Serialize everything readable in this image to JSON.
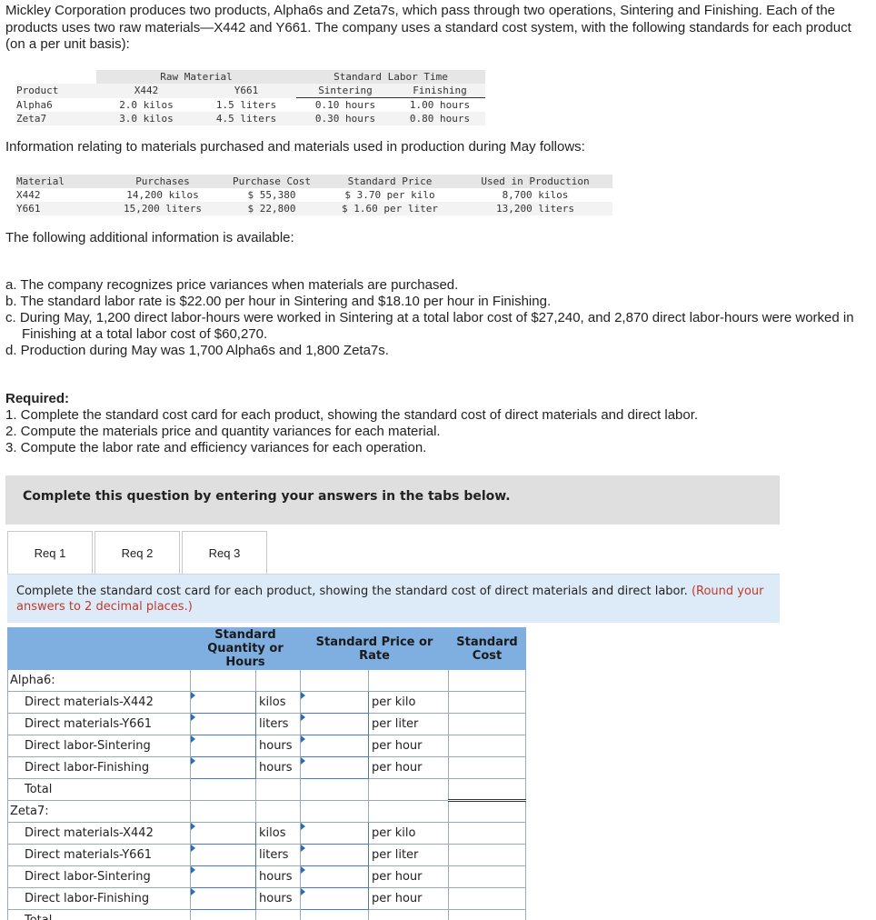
{
  "intro": "Mickley Corporation produces two products, Alpha6s and Zeta7s, which pass through two operations, Sintering and Finishing. Each of the products uses two raw materials—X442 and Y661. The company uses a standard cost system, with the following standards for each product (on a per unit basis):",
  "std_table": {
    "group_raw": "Raw Material",
    "group_labor": "Standard Labor Time",
    "col_product": "Product",
    "col_x442": "X442",
    "col_y661": "Y661",
    "col_sinter": "Sintering",
    "col_finish": "Finishing",
    "rows": [
      {
        "product": "Alpha6",
        "x442": "2.0 kilos",
        "y661": "1.5 liters",
        "sinter": "0.10 hours",
        "finish": "1.00 hours"
      },
      {
        "product": "Zeta7",
        "x442": "3.0 kilos",
        "y661": "4.5 liters",
        "sinter": "0.30 hours",
        "finish": "0.80 hours"
      }
    ]
  },
  "materials_intro": "Information relating to materials purchased and materials used in production during May follows:",
  "mat_table": {
    "col_material": "Material",
    "col_purchases": "Purchases",
    "col_cost": "Purchase Cost",
    "col_price": "Standard Price",
    "col_used": "Used in Production",
    "rows": [
      {
        "material": "X442",
        "purchases": "14,200 kilos",
        "cost": "$ 55,380",
        "price": "$ 3.70 per kilo",
        "used": "8,700 kilos"
      },
      {
        "material": "Y661",
        "purchases": "15,200 liters",
        "cost": "$ 22,800",
        "price": "$ 1.60 per liter",
        "used": "13,200 liters"
      }
    ]
  },
  "additional": "The following additional information is available:",
  "items": [
    "a. The company recognizes price variances when materials are purchased.",
    "b. The standard labor rate is $22.00 per hour in Sintering and $18.10 per hour in Finishing.",
    "c. During May, 1,200 direct labor-hours were worked in Sintering at a total labor cost of $27,240, and 2,870 direct labor-hours were worked in Finishing at a total labor cost of $60,270.",
    "d. Production during May was 1,700 Alpha6s and 1,800 Zeta7s."
  ],
  "required": {
    "title": "Required:",
    "lines": [
      "1. Complete the standard cost card for each product, showing the standard cost of direct materials and direct labor.",
      "2. Compute the materials price and quantity variances for each material.",
      "3. Compute the labor rate and efficiency variances for each operation."
    ]
  },
  "banner": "Complete this question by entering your answers in the tabs below.",
  "tabs": [
    "Req 1",
    "Req 2",
    "Req 3"
  ],
  "instruction": "Complete the standard cost card for each product, showing the standard cost of direct materials and direct labor.",
  "instruction_note": "(Round your answers to 2 decimal places.)",
  "grid": {
    "h_qty": "Standard Quantity or Hours",
    "h_price": "Standard Price or Rate",
    "h_cost": "Standard Cost",
    "alpha_label": "Alpha6:",
    "zeta_label": "Zeta7:",
    "total_label": "Total",
    "row_labels": [
      "Direct materials-X442",
      "Direct materials-Y661",
      "Direct labor-Sintering",
      "Direct labor-Finishing"
    ],
    "units": [
      "kilos",
      "liters",
      "hours",
      "hours"
    ],
    "per_units": [
      "per kilo",
      "per liter",
      "per hour",
      "per hour"
    ]
  }
}
